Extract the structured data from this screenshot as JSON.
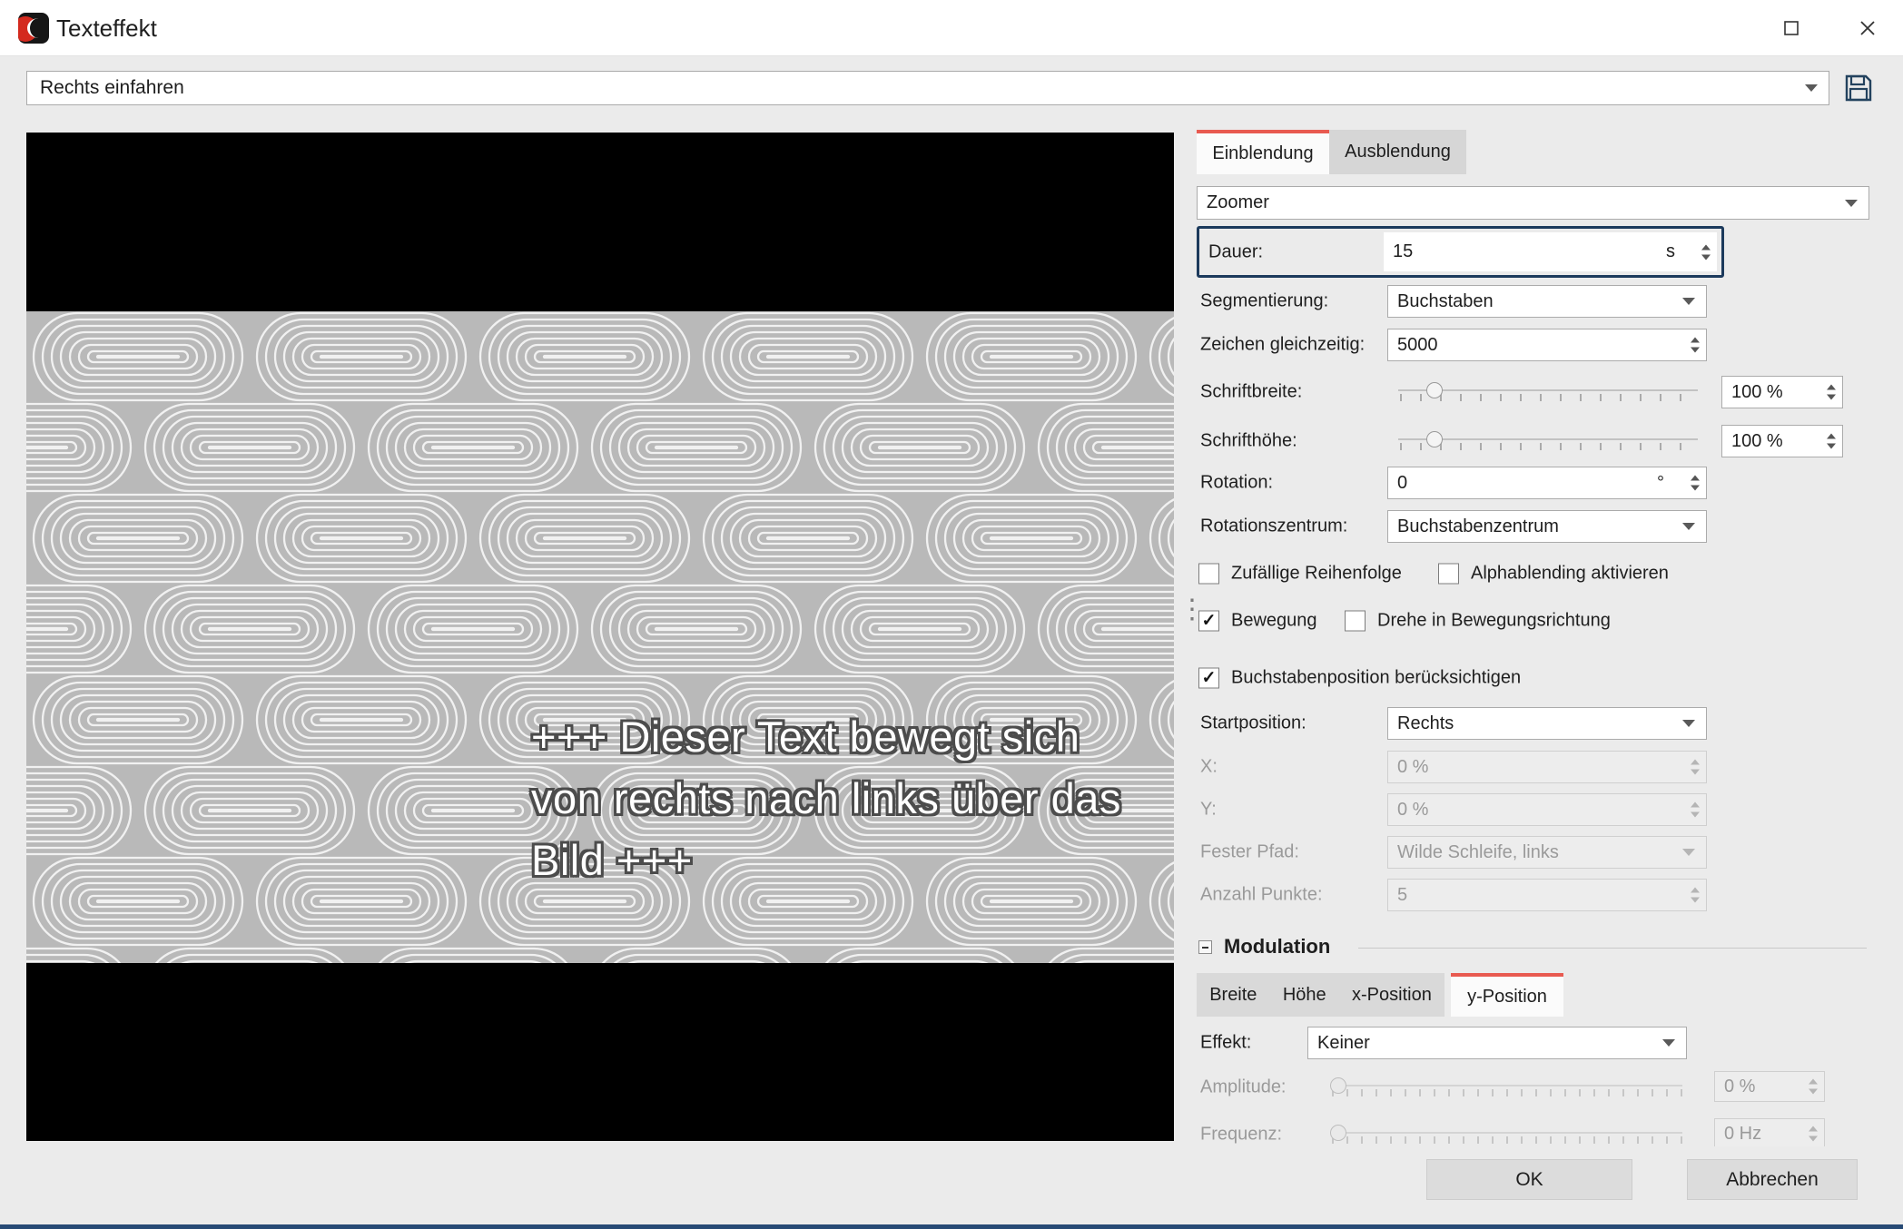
{
  "window": {
    "title": "Texteffekt"
  },
  "preset": {
    "value": "Rechts einfahren"
  },
  "preview": {
    "lines": [
      "+++ Dieser Text bewegt sich",
      "von rechts nach links über das",
      "Bild +++"
    ]
  },
  "tabs": {
    "einblendung": "Einblendung",
    "ausblendung": "Ausblendung"
  },
  "effect": {
    "value": "Zoomer"
  },
  "fields": {
    "dauer": {
      "label": "Dauer:",
      "value": "15",
      "unit": "s"
    },
    "segmentierung": {
      "label": "Segmentierung:",
      "value": "Buchstaben"
    },
    "zeichen_gleichzeitig": {
      "label": "Zeichen gleichzeitig:",
      "value": "5000"
    },
    "schriftbreite": {
      "label": "Schriftbreite:",
      "value": "100 %"
    },
    "schrifthoehe": {
      "label": "Schrifthöhe:",
      "value": "100 %"
    },
    "rotation": {
      "label": "Rotation:",
      "value": "0",
      "unit": "°"
    },
    "rotationszentrum": {
      "label": "Rotationszentrum:",
      "value": "Buchstabenzentrum"
    },
    "startposition": {
      "label": "Startposition:",
      "value": "Rechts"
    },
    "x": {
      "label": "X:",
      "value": "0 %"
    },
    "y": {
      "label": "Y:",
      "value": "0 %"
    },
    "fester_pfad": {
      "label": "Fester Pfad:",
      "value": "Wilde Schleife, links"
    },
    "anzahl_punkte": {
      "label": "Anzahl Punkte:",
      "value": "5"
    }
  },
  "checkboxes": {
    "zufaellige_reihenfolge": {
      "label": "Zufällige Reihenfolge",
      "checked": false
    },
    "alphablending": {
      "label": "Alphablending aktivieren",
      "checked": false
    },
    "bewegung": {
      "label": "Bewegung",
      "checked": true
    },
    "drehe": {
      "label": "Drehe in Bewegungsrichtung",
      "checked": false
    },
    "buchstabenposition": {
      "label": "Buchstabenposition berücksichtigen",
      "checked": true
    }
  },
  "modulation": {
    "title": "Modulation",
    "tabs": {
      "breite": "Breite",
      "hoehe": "Höhe",
      "x_position": "x-Position",
      "y_position": "y-Position"
    },
    "effekt": {
      "label": "Effekt:",
      "value": "Keiner"
    },
    "amplitude": {
      "label": "Amplitude:",
      "value": "0 %"
    },
    "frequenz": {
      "label": "Frequenz:",
      "value": "0 Hz"
    }
  },
  "buttons": {
    "ok": "OK",
    "cancel": "Abbrechen"
  },
  "icons": {
    "check": "✓",
    "dots": "⋮"
  },
  "colors": {
    "accent_red": "#e85a50",
    "highlight_navy": "#1c3a5c",
    "preview_gray": "#b9b9b9"
  }
}
